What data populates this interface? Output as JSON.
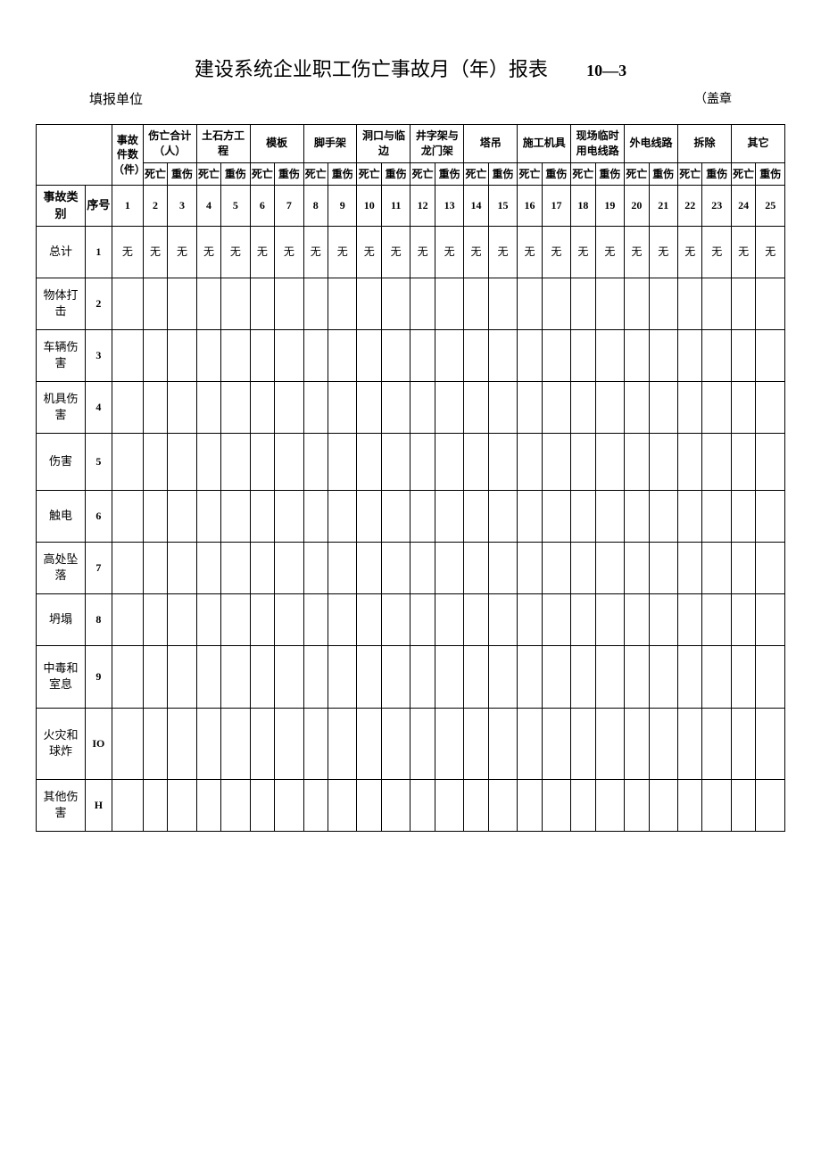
{
  "header": {
    "title": "建设系统企业职工伤亡事故月（年）报表",
    "code": "10—3",
    "unit_label": "填报单位",
    "stamp": "（盖章"
  },
  "colgroups": [
    "事故件数（件）",
    "伤亡合计（人）",
    "土石方工程",
    "模板",
    "脚手架",
    "洞口与临边",
    "井字架与龙门架",
    "塔吊",
    "施工机具",
    "现场临时用电线路",
    "外电线路",
    "拆除",
    "其它"
  ],
  "subcols": {
    "death": "死亡",
    "injury": "重伤"
  },
  "header_rowlabels": {
    "category": "事故类别",
    "seq": "序号"
  },
  "col_numbers": [
    "1",
    "2",
    "3",
    "4",
    "5",
    "6",
    "7",
    "8",
    "9",
    "10",
    "11",
    "12",
    "13",
    "14",
    "15",
    "16",
    "17",
    "18",
    "19",
    "20",
    "21",
    "22",
    "23",
    "24",
    "25"
  ],
  "rows": [
    {
      "label": "总计",
      "seq": "1",
      "cells": [
        "无",
        "无",
        "无",
        "无",
        "无",
        "无",
        "无",
        "无",
        "无",
        "无",
        "无",
        "无",
        "无",
        "无",
        "无",
        "无",
        "无",
        "无",
        "无",
        "无",
        "无",
        "无",
        "无",
        "无",
        "无"
      ]
    },
    {
      "label": "物体打击",
      "seq": "2",
      "cells": [
        "",
        "",
        "",
        "",
        "",
        "",
        "",
        "",
        "",
        "",
        "",
        "",
        "",
        "",
        "",
        "",
        "",
        "",
        "",
        "",
        "",
        "",
        "",
        "",
        ""
      ]
    },
    {
      "label": "车辆伤害",
      "seq": "3",
      "cells": [
        "",
        "",
        "",
        "",
        "",
        "",
        "",
        "",
        "",
        "",
        "",
        "",
        "",
        "",
        "",
        "",
        "",
        "",
        "",
        "",
        "",
        "",
        "",
        "",
        ""
      ]
    },
    {
      "label": "机具伤害",
      "seq": "4",
      "cells": [
        "",
        "",
        "",
        "",
        "",
        "",
        "",
        "",
        "",
        "",
        "",
        "",
        "",
        "",
        "",
        "",
        "",
        "",
        "",
        "",
        "",
        "",
        "",
        "",
        ""
      ]
    },
    {
      "label": "伤害",
      "seq": "5",
      "cells": [
        "",
        "",
        "",
        "",
        "",
        "",
        "",
        "",
        "",
        "",
        "",
        "",
        "",
        "",
        "",
        "",
        "",
        "",
        "",
        "",
        "",
        "",
        "",
        "",
        ""
      ]
    },
    {
      "label": "触电",
      "seq": "6",
      "cells": [
        "",
        "",
        "",
        "",
        "",
        "",
        "",
        "",
        "",
        "",
        "",
        "",
        "",
        "",
        "",
        "",
        "",
        "",
        "",
        "",
        "",
        "",
        "",
        "",
        ""
      ]
    },
    {
      "label": "高处坠落",
      "seq": "7",
      "cells": [
        "",
        "",
        "",
        "",
        "",
        "",
        "",
        "",
        "",
        "",
        "",
        "",
        "",
        "",
        "",
        "",
        "",
        "",
        "",
        "",
        "",
        "",
        "",
        "",
        ""
      ]
    },
    {
      "label": "坍塌",
      "seq": "8",
      "cells": [
        "",
        "",
        "",
        "",
        "",
        "",
        "",
        "",
        "",
        "",
        "",
        "",
        "",
        "",
        "",
        "",
        "",
        "",
        "",
        "",
        "",
        "",
        "",
        "",
        ""
      ]
    },
    {
      "label": "中毒和室息",
      "seq": "9",
      "cells": [
        "",
        "",
        "",
        "",
        "",
        "",
        "",
        "",
        "",
        "",
        "",
        "",
        "",
        "",
        "",
        "",
        "",
        "",
        "",
        "",
        "",
        "",
        "",
        "",
        ""
      ]
    },
    {
      "label": "火灾和球炸",
      "seq": "IO",
      "cells": [
        "",
        "",
        "",
        "",
        "",
        "",
        "",
        "",
        "",
        "",
        "",
        "",
        "",
        "",
        "",
        "",
        "",
        "",
        "",
        "",
        "",
        "",
        "",
        "",
        ""
      ]
    },
    {
      "label": "其他伤害",
      "seq": "H",
      "cells": [
        "",
        "",
        "",
        "",
        "",
        "",
        "",
        "",
        "",
        "",
        "",
        "",
        "",
        "",
        "",
        "",
        "",
        "",
        "",
        "",
        "",
        "",
        "",
        "",
        ""
      ]
    }
  ]
}
